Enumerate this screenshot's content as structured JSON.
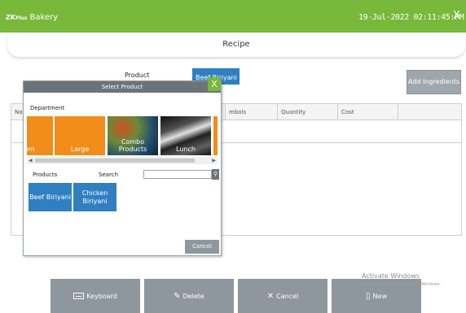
{
  "app": {
    "brand_zk": "ZK",
    "brand_plus": "Plus",
    "title": "Bakery",
    "datetime": "19-Jul-2022 02:11:45:PM",
    "close_glyph": "X"
  },
  "page": {
    "title": "Recipe"
  },
  "form": {
    "product_label": "Product",
    "product_value": "Beef Biriyani",
    "add_ingredients_label": "Add Ingredients"
  },
  "table": {
    "columns": [
      "Na",
      "mbols",
      "Quantity",
      "Cost"
    ]
  },
  "footer": {
    "keyboard_label": "Keyboard",
    "delete_label": "Delete",
    "cancel_label": "Cancel",
    "new_label": "New",
    "watermark_title": "Activate Windows",
    "watermark_sub": "Go to PC settings to activate Windows."
  },
  "modal": {
    "title": "Select Product",
    "close_glyph": "X",
    "department_label": "Department",
    "departments": [
      "lium",
      "Large",
      "Combo Products",
      "Lunch",
      ""
    ],
    "products_label": "Products",
    "search_label": "Search",
    "search_value": "",
    "products": [
      "Beef Biriyani",
      "Chicken Biriyani"
    ],
    "cancel_label": "Cancel"
  },
  "colors": {
    "titlebar": "#78b83a",
    "product_blue": "#2f7fc1",
    "department_orange": "#f28c1a",
    "button_gray": "#8e979e"
  },
  "icons": {
    "keyboard": "keyboard-icon",
    "delete": "delete-icon",
    "cancel": "cancel-x-icon",
    "new": "new-icon",
    "search": "search-icon"
  }
}
